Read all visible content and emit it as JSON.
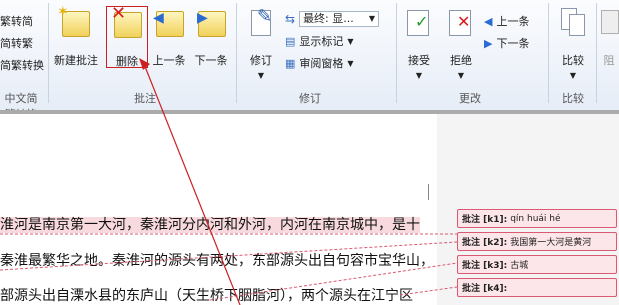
{
  "ribbon": {
    "chinese_convert": {
      "items": [
        "繁转简",
        "简转繁",
        "简繁转换"
      ],
      "group_label": "中文简繁转换"
    },
    "comments": {
      "buttons": [
        "新建批注",
        "删除",
        "上一条",
        "下一条"
      ],
      "group_label": "批注"
    },
    "tracking": {
      "track_label": "修订",
      "final_view": "最终: 显...",
      "show_markup": "显示标记",
      "review_pane": "审阅窗格",
      "group_label": "修订"
    },
    "changes": {
      "accept": "接受",
      "reject": "拒绝",
      "prev": "上一条",
      "next": "下一条",
      "group_label": "更改"
    },
    "compare": {
      "label": "比较",
      "group_label": "比较"
    },
    "protect": {
      "label": "阻"
    }
  },
  "document": {
    "lines": [
      "淮河是南京第一大河，秦淮河分内河和外河，内河在南京城中，是十",
      "秦淮最繁华之地。秦淮河的源头有两处，东部源头出自句容市宝华山，",
      "部源头出自溧水县的东庐山（天生桥下胭脂河），两个源头在江宁区"
    ]
  },
  "comments": [
    {
      "tag": "批注 [k1]:",
      "text": "qín huái hé"
    },
    {
      "tag": "批注 [k2]:",
      "text": "我国第一大河是黄河"
    },
    {
      "tag": "批注 [k3]:",
      "text": "古城"
    },
    {
      "tag": "批注 [k4]:",
      "text": ""
    }
  ],
  "colors": {
    "comment_border": "#d95a72",
    "comment_fill": "#fde6ea",
    "arrow": "#cc2020"
  }
}
